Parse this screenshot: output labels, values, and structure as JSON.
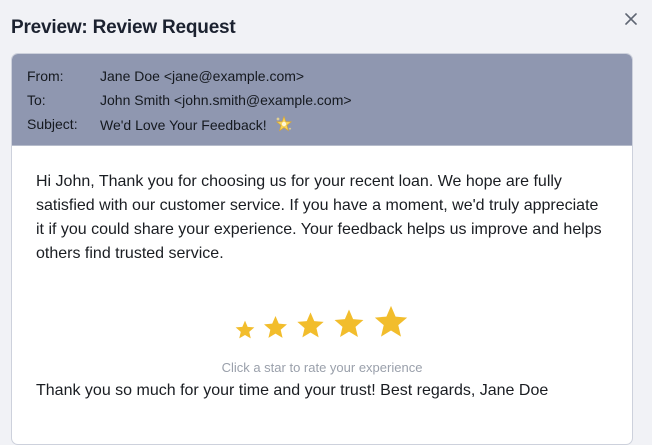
{
  "dialog": {
    "title": "Preview: Review Request",
    "close_icon": "close-icon"
  },
  "email": {
    "from_label": "From:",
    "from_value": "Jane Doe <jane@example.com>",
    "to_label": "To:",
    "to_value": "John Smith <john.smith@example.com>",
    "subject_label": "Subject:",
    "subject_value": "We'd Love Your Feedback!",
    "subject_icon": "sparkle-star-icon",
    "body_intro": "Hi John, Thank you for choosing us for your recent loan. We hope are fully satisfied with our customer service. If you have a moment, we'd truly appreciate it if you could share your experience. Your feedback helps us improve and helps others find trusted service.",
    "rating": {
      "star_count": 5,
      "star_color": "#f2bd2c",
      "hint": "Click a star to rate your experience"
    },
    "closing": "Thank you so much for your time and your trust! Best regards, Jane Doe"
  },
  "colors": {
    "header_bg": "#8f97b0",
    "page_bg": "#f1f2f6"
  }
}
